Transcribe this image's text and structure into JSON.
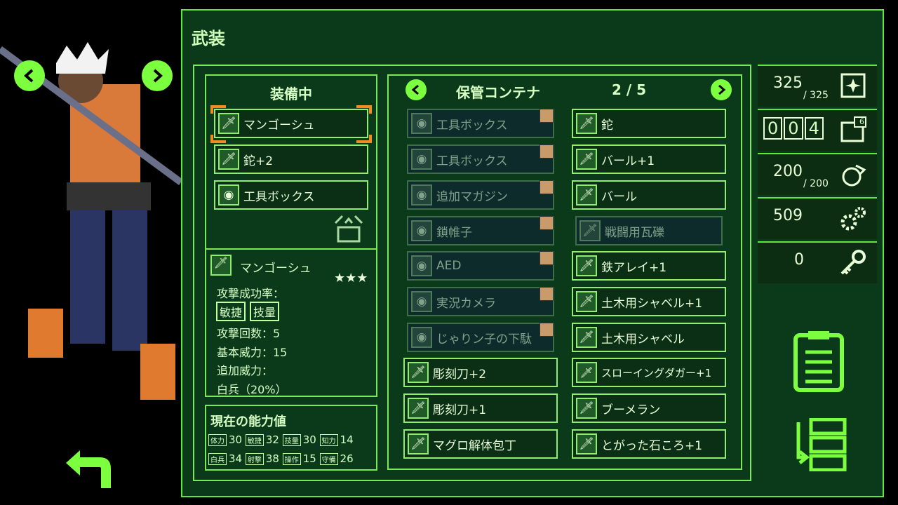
{
  "title": "武装",
  "equipped": {
    "header": "装備中",
    "items": [
      "マンゴーシュ",
      "鉈+2",
      "工具ボックス"
    ]
  },
  "detail": {
    "name": "マンゴーシュ",
    "stars": "★★★",
    "attack_rate_label": "攻撃成功率：",
    "attr_tags": [
      "敏捷",
      "技量"
    ],
    "attack_count": "攻撃回数：5",
    "base_power": "基本威力：15",
    "add_power_label": "追加威力：",
    "add_power_value": "白兵（20%）"
  },
  "abilities": {
    "header": "現在の能力値",
    "row1": [
      [
        "体力",
        "30"
      ],
      [
        "敏捷",
        "32"
      ],
      [
        "技量",
        "30"
      ],
      [
        "知力",
        "14"
      ]
    ],
    "row2": [
      [
        "白兵",
        "34"
      ],
      [
        "射撃",
        "38"
      ],
      [
        "操作",
        "15"
      ],
      [
        "守備",
        "26"
      ]
    ]
  },
  "storage": {
    "header": "保管コンテナ",
    "page": "2 / 5",
    "left_col": [
      "工具ボックス",
      "工具ボックス",
      "追加マガジン",
      "鎖帷子",
      "AED",
      "実況カメラ",
      "じゃりン子の下駄",
      "彫刻刀+2",
      "彫刻刀+1",
      "マグロ解体包丁"
    ],
    "right_col": [
      "鉈",
      "バール+1",
      "バール",
      "戦闘用瓦礫",
      "鉄アレイ+1",
      "土木用シャベル+1",
      "土木用シャベル",
      "スローイングダガー+1",
      "ブーメラン",
      "とがった石ころ+1"
    ]
  },
  "resources": {
    "r1_value": "325",
    "r1_max": "/ 325",
    "r2_digits": [
      "0",
      "0",
      "4"
    ],
    "r2_badge": "6",
    "r3_value": "200",
    "r3_max": "/ 200",
    "r4_value": "509",
    "r5_value": "0"
  }
}
